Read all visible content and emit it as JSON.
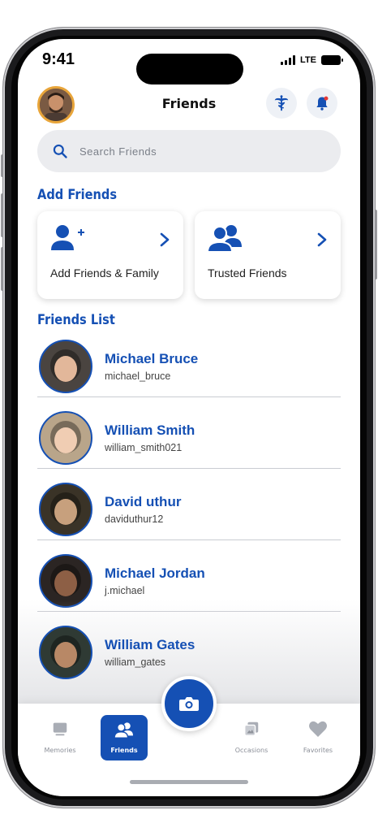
{
  "status": {
    "time": "9:41",
    "network": "LTE"
  },
  "header": {
    "title": "Friends"
  },
  "search": {
    "placeholder": "Search Friends"
  },
  "add_friends": {
    "title": "Add Friends",
    "cards": [
      {
        "label": "Add Friends & Family",
        "icon": "add-person-icon"
      },
      {
        "label": "Trusted Friends",
        "icon": "group-icon"
      }
    ]
  },
  "friends_list": {
    "title": "Friends List",
    "items": [
      {
        "name": "Michael Bruce",
        "handle": "michael_bruce"
      },
      {
        "name": "William Smith",
        "handle": "william_smith021"
      },
      {
        "name": "David uthur",
        "handle": "daviduthur12"
      },
      {
        "name": "Michael Jordan",
        "handle": "j.michael"
      },
      {
        "name": "William Gates",
        "handle": "william_gates"
      }
    ]
  },
  "tabbar": {
    "tabs": [
      {
        "label": "Memories",
        "icon": "memories-icon"
      },
      {
        "label": "Friends",
        "icon": "friends-icon",
        "active": true
      },
      {
        "label": "Occasions",
        "icon": "occasions-icon"
      },
      {
        "label": "Favorites",
        "icon": "heart-icon"
      }
    ]
  },
  "colors": {
    "accent": "#1550b4",
    "avatar_ring": "#e8a53a",
    "background": "#ffffff"
  }
}
